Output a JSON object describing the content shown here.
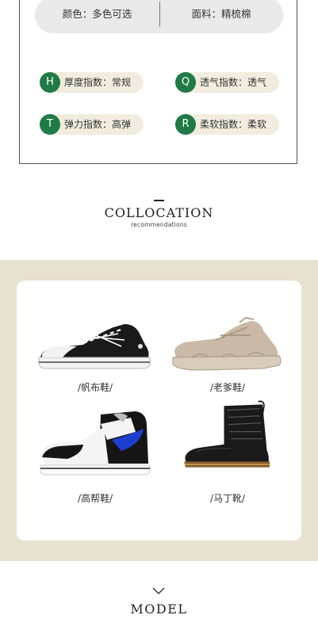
{
  "specs": {
    "color": "颜色：多色可选",
    "fabric": "面料：精梳棉"
  },
  "indices": [
    {
      "letter": "H",
      "label": "厚度指数：常规"
    },
    {
      "letter": "Q",
      "label": "透气指数：透气"
    },
    {
      "letter": "T",
      "label": "弹力指数：高弹"
    },
    {
      "letter": "R",
      "label": "柔软指数：柔软"
    }
  ],
  "collocation": {
    "title": "COLLOCATION",
    "subtitle": "recommendations",
    "items": [
      {
        "label": "/帆布鞋/",
        "icon": "canvas-shoe-image"
      },
      {
        "label": "/老爹鞋/",
        "icon": "chunky-sneaker-image"
      },
      {
        "label": "/高帮鞋/",
        "icon": "high-top-sneaker-image"
      },
      {
        "label": "/马丁靴/",
        "icon": "martin-boot-image"
      }
    ]
  },
  "model": {
    "title": "MODEL"
  },
  "colors": {
    "badge": "#1f7a47",
    "tag": "#f1ecde",
    "beige": "#e7e1d1",
    "pill": "#e9e9e9"
  }
}
